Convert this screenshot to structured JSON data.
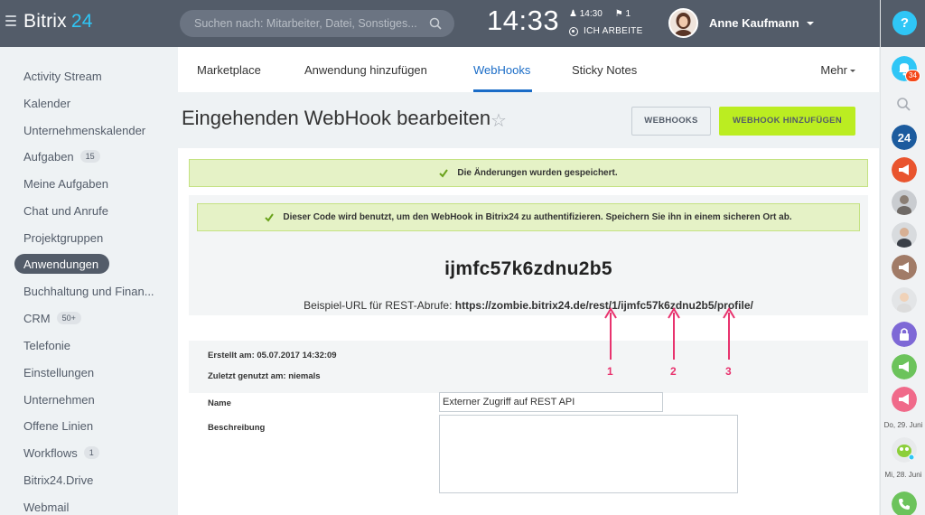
{
  "header": {
    "logo_text": "Bitrix",
    "logo_number": "24",
    "search_placeholder": "Suchen nach: Mitarbeiter, Datei, Sonstiges...",
    "clock": "14:33",
    "alarm_time": "14:30",
    "flag_count": "1",
    "work_status": "ICH ARBEITE",
    "user_name": "Anne Kaufmann"
  },
  "sidebar": {
    "items": [
      {
        "label": "Activity Stream"
      },
      {
        "label": "Kalender"
      },
      {
        "label": "Unternehmenskalender"
      },
      {
        "label": "Aufgaben",
        "counter": "15"
      },
      {
        "label": "Meine Aufgaben"
      },
      {
        "label": "Chat und Anrufe"
      },
      {
        "label": "Projektgruppen"
      },
      {
        "label": "Anwendungen",
        "active": true
      },
      {
        "label": "Buchhaltung und Finan..."
      },
      {
        "label": "CRM",
        "counter": "50+"
      },
      {
        "label": "Telefonie"
      },
      {
        "label": "Einstellungen"
      },
      {
        "label": "Unternehmen"
      },
      {
        "label": "Offene Linien"
      },
      {
        "label": "Workflows",
        "counter": "1"
      },
      {
        "label": "Bitrix24.Drive"
      },
      {
        "label": "Webmail"
      }
    ]
  },
  "tabs": {
    "items": [
      "Marketplace",
      "Anwendung hinzufügen",
      "WebHooks",
      "Sticky Notes"
    ],
    "active": "WebHooks",
    "more": "Mehr"
  },
  "page": {
    "title": "Eingehenden WebHook bearbeiten",
    "btn_webhooks": "WEBHOOKS",
    "btn_add": "WEBHOOK HINZUFÜGEN"
  },
  "notices": {
    "saved": "Die Änderungen wurden gespeichert.",
    "code_info": "Dieser Code wird benutzt, um den WebHook in Bitrix24 zu authentifizieren. Speichern Sie ihn in einem sicheren Ort ab."
  },
  "webhook": {
    "code": "ijmfc57k6zdnu2b5",
    "url_label": "Beispiel-URL für REST-Abrufe:",
    "url": "https://zombie.bitrix24.de/rest/1/ijmfc57k6zdnu2b5/profile/",
    "created": "Erstellt am: 05.07.2017 14:32:09",
    "last_used": "Zuletzt genutzt am: niemals"
  },
  "annotations": [
    "1",
    "2",
    "3"
  ],
  "form": {
    "name_label": "Name",
    "name_value": "Externer Zugriff auf REST API",
    "desc_label": "Beschreibung"
  },
  "right_panel": {
    "help": "?",
    "notifications_count": "34",
    "date1": "Do, 29. Juni",
    "date2": "Mi, 28. Juni"
  },
  "colors": {
    "header_bg": "#535c69",
    "accent_blue": "#2fc6f6",
    "accent_green": "#bbed21",
    "annotation_red": "#e8336e"
  }
}
